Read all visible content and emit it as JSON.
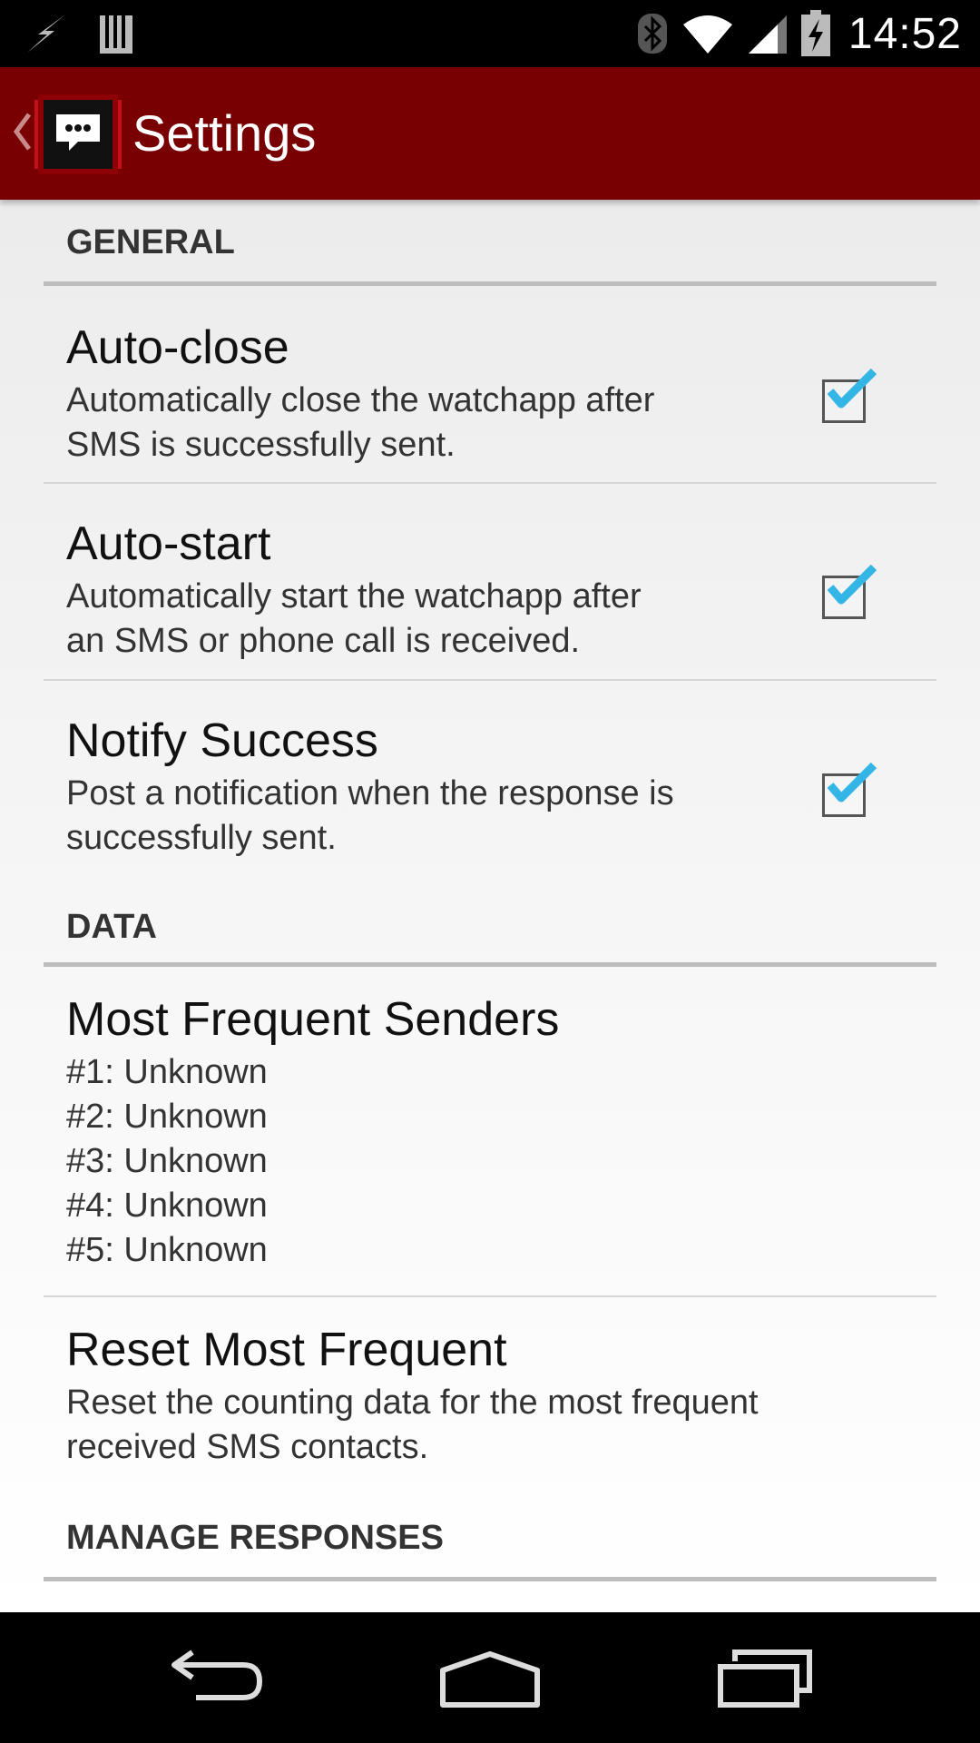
{
  "status_bar": {
    "time": "14:52",
    "left_icons": [
      "flash-icon",
      "sd-card-icon"
    ],
    "right_icons": [
      "bluetooth-icon",
      "wifi-icon",
      "signal-icon",
      "battery-charging-icon"
    ]
  },
  "action_bar": {
    "back_icon": "chevron-left-icon",
    "app_icon": "chat-bubble-icon",
    "title": "Settings"
  },
  "settings": {
    "general": {
      "header": "GENERAL",
      "auto_close": {
        "title": "Auto-close",
        "summary_lines": [
          "Automatically close the watchapp after",
          "SMS is successfully sent."
        ],
        "checked": true
      },
      "auto_start": {
        "title": "Auto-start",
        "summary_lines": [
          "Automatically start the watchapp after",
          "an SMS or phone call is received."
        ],
        "checked": true
      },
      "notify_success": {
        "title": "Notify Success",
        "summary_lines": [
          "Post a notification when the response is",
          "successfully sent."
        ],
        "checked": true
      }
    },
    "data": {
      "header": "DATA",
      "most_frequent": {
        "title": "Most Frequent Senders",
        "senders": [
          "#1: Unknown",
          "#2: Unknown",
          "#3: Unknown",
          "#4: Unknown",
          "#5: Unknown"
        ]
      },
      "reset": {
        "title": "Reset Most Frequent",
        "summary_lines": [
          "Reset the counting data for the most frequent",
          "received SMS contacts."
        ]
      }
    },
    "manage": {
      "header": "MANAGE RESPONSES"
    }
  },
  "nav_bar": {
    "buttons": [
      "back-icon",
      "home-icon",
      "recents-icon"
    ]
  },
  "colors": {
    "action_bar": "#780003",
    "checkmark": "#33b5e5"
  }
}
